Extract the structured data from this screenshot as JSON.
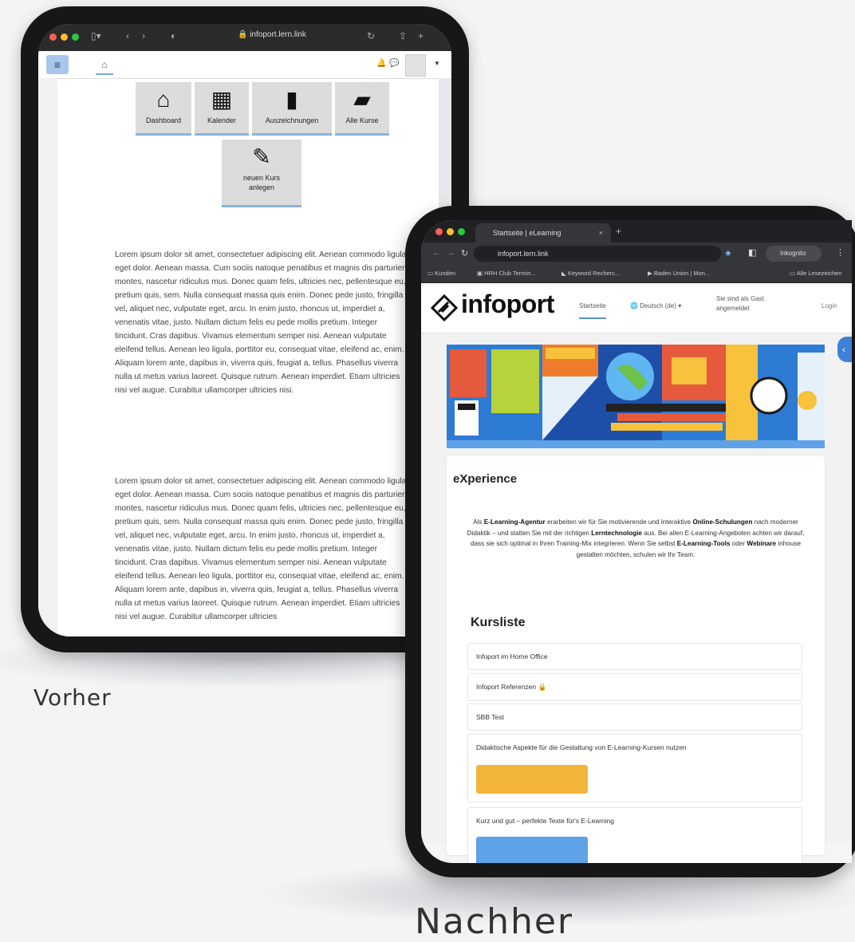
{
  "captions": {
    "before": "Vorher",
    "after": "Nachher"
  },
  "before": {
    "browser": {
      "url": "infoport.lern.link"
    },
    "tiles": [
      {
        "icon": "home-icon",
        "glyph": "🏠",
        "label": "Dashboard"
      },
      {
        "icon": "calendar-icon",
        "glyph": "📅",
        "label": "Kalender"
      },
      {
        "icon": "bookmark-icon",
        "glyph": "🔖",
        "label": "Auszeichnungen"
      },
      {
        "icon": "book-icon",
        "glyph": "📘",
        "label": "Alle Kurse"
      },
      {
        "icon": "edit-icon",
        "glyph": "✎",
        "label": "neuen Kurs anlegen"
      }
    ],
    "paragraph_1": "Lorem ipsum dolor sit amet, consectetuer adipiscing elit. Aenean commodo ligula eget dolor. Aenean massa. Cum sociis natoque penatibus et magnis dis parturient montes, nascetur ridiculus mus. Donec quam felis, ultricies nec, pellentesque eu, pretium quis, sem. Nulla consequat massa quis enim. Donec pede justo, fringilla vel, aliquet nec, vulputate eget, arcu. In enim justo, rhoncus ut, imperdiet a, venenatis vitae, justo. Nullam dictum felis eu pede mollis pretium. Integer tincidunt. Cras dapibus. Vivamus elementum semper nisi. Aenean vulputate eleifend tellus. Aenean leo ligula, porttitor eu, consequat vitae, eleifend ac, enim. Aliquam lorem ante, dapibus in, viverra quis, feugiat a, tellus. Phasellus viverra nulla ut metus varius laoreet. Quisque rutrum. Aenean imperdiet. Etiam ultricies nisi vel augue. Curabitur ullamcorper ultricies nisi.",
    "paragraph_2": "Lorem ipsum dolor sit amet, consectetuer adipiscing elit. Aenean commodo ligula eget dolor. Aenean massa. Cum sociis natoque penatibus et magnis dis parturient montes, nascetur ridiculus mus. Donec quam felis, ultricies nec, pellentesque eu, pretium quis, sem. Nulla consequat massa quis enim. Donec pede justo, fringilla vel, aliquet nec, vulputate eget, arcu. In enim justo, rhoncus ut, imperdiet a, venenatis vitae, justo. Nullam dictum felis eu pede mollis pretium. Integer tincidunt. Cras dapibus. Vivamus elementum semper nisi. Aenean vulputate eleifend tellus. Aenean leo ligula, porttitor eu, consequat vitae, eleifend ac, enim. Aliquam lorem ante, dapibus in, viverra quis, feugiat a, tellus. Phasellus viverra nulla ut metus varius laoreet. Quisque rutrum. Aenean imperdiet. Etiam ultricies nisi vel augue. Curabitur ullamcorper ultricies"
  },
  "after": {
    "browser": {
      "tab_title": "Startseite | eLearning",
      "url": "infoport.lern.link",
      "incognito": "Inkognito",
      "bookmarks": [
        "Kunden",
        "HRH Club Termin...",
        "Keyword Recherc...",
        "Baden Union | Mon...",
        "Alle Lesezeichen"
      ]
    },
    "site": {
      "logo": "infoport",
      "nav_home": "Startseite",
      "nav_lang": "Deutsch (de)",
      "guest": "Sie sind als Gast angemeldet",
      "login": "Login"
    },
    "section_title": "eXperience",
    "intro": {
      "p1": "Als ",
      "b1": "E-Learning-Agentur",
      "p2": " erarbeiten wir für Sie motivierende und interaktive ",
      "b2": "Online-Schulungen",
      "p3": " nach moderner Didaktik – und statten Sie mit der richtigen ",
      "b3": "Lerntechnologie",
      "p4": " aus. Bei allen E-Learning-Angeboten achten wir darauf, dass sie sich optimal in Ihren Training-Mix integrieren. Wenn Sie selbst ",
      "b4": "E-Learning-Tools",
      "p5": " oder ",
      "b5": "Webinare",
      "p6": " inhouse gestalten möchten, schulen wir Ihr Team."
    },
    "course_list_title": "Kursliste",
    "courses": [
      "Infoport im Home Office",
      "Infoport Referenzen 🔒",
      "SBB Test",
      "Didaktische Aspekte für die Gestaltung von E-Learning-Kursen nutzen",
      "Kurz und gut – perfekte Texte für's E-Learning"
    ],
    "colors": {
      "accent": "#3f7fd6",
      "thumb_1": "#f2b53a",
      "thumb_2": "#5ea2e8"
    }
  }
}
